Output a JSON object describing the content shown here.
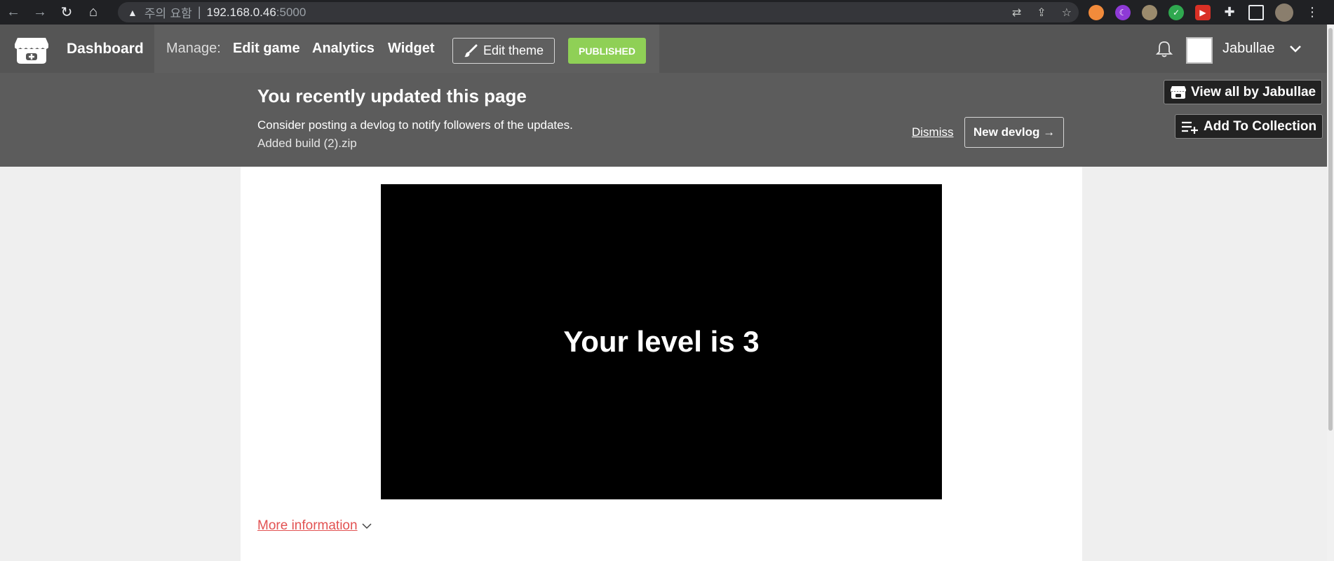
{
  "browser": {
    "security_warning": "주의 요함",
    "url_host": "192.168.0.46",
    "url_port": ":5000"
  },
  "header": {
    "dashboard": "Dashboard",
    "manage_label": "Manage:",
    "edit_game": "Edit game",
    "analytics": "Analytics",
    "widget": "Widget",
    "edit_theme": "Edit theme",
    "published": "PUBLISHED",
    "username": "Jabullae"
  },
  "notice": {
    "title": "You recently updated this page",
    "line1": "Consider posting a devlog to notify followers of the updates.",
    "line2": "Added build (2).zip",
    "dismiss": "Dismiss",
    "new_devlog": "New devlog →"
  },
  "side": {
    "view_all": "View all by Jabullae",
    "add_collection": "Add To Collection"
  },
  "game": {
    "text": "Your level is 3"
  },
  "content": {
    "more_info": "More information"
  },
  "colors": {
    "published": "#8fd056",
    "link": "#e25252"
  }
}
